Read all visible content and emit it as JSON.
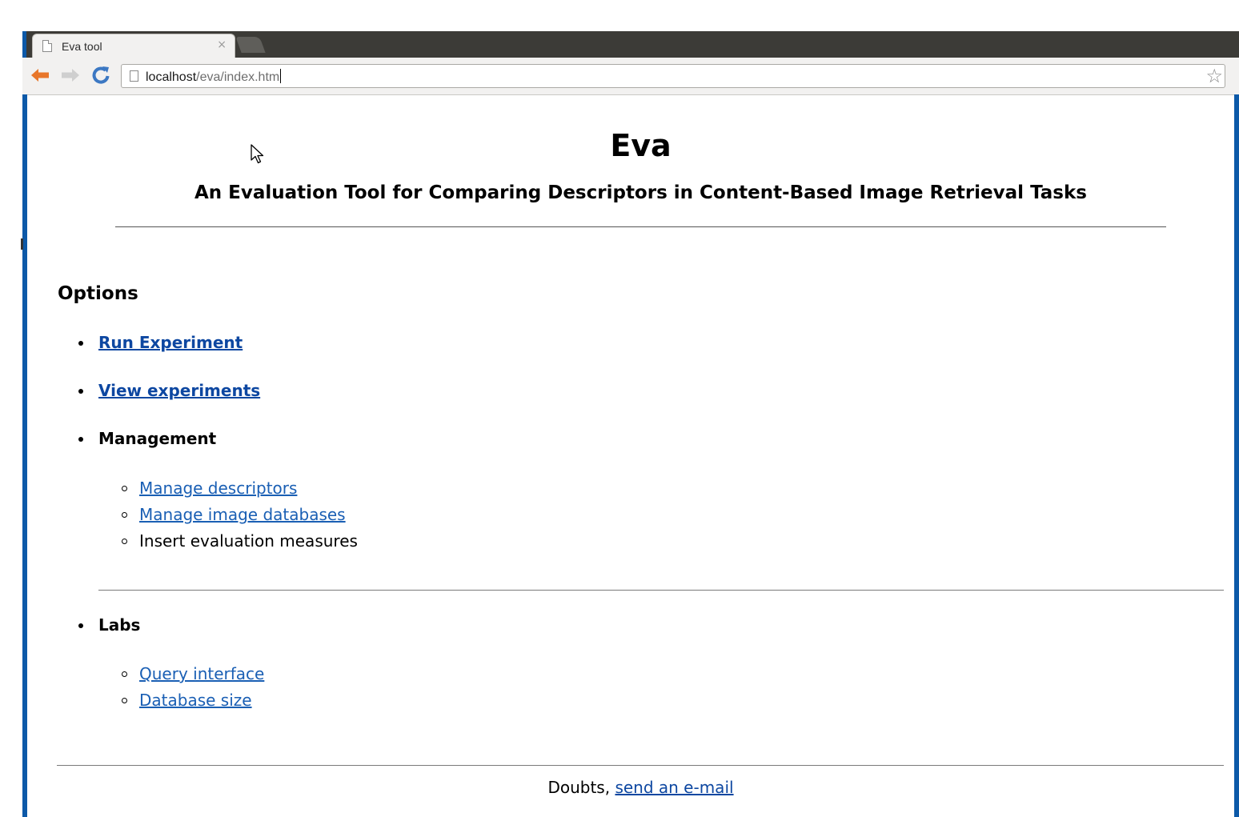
{
  "browser": {
    "tab_title": "Eva tool",
    "tab_close": "×",
    "url_host": "localhost",
    "url_path": "/eva/index.htm",
    "back_icon": "back-arrow-icon",
    "forward_icon": "forward-arrow-icon",
    "reload_icon": "reload-icon",
    "bookmark_icon": "star-icon",
    "accent_color": "#0c59a8"
  },
  "page": {
    "title": "Eva",
    "subtitle": "An Evaluation Tool for Comparing Descriptors in Content-Based Image Retrieval Tasks",
    "options_heading": "Options",
    "options": {
      "run_experiment": "Run Experiment",
      "view_experiments": "View experiments",
      "management": {
        "label": "Management",
        "items": [
          "Manage descriptors",
          "Manage image databases",
          "Insert evaluation measures"
        ]
      },
      "labs": {
        "label": "Labs",
        "items": [
          "Query interface",
          "Database size"
        ]
      }
    },
    "footer": {
      "text": "Doubts,",
      "link": "send an e-mail"
    }
  }
}
